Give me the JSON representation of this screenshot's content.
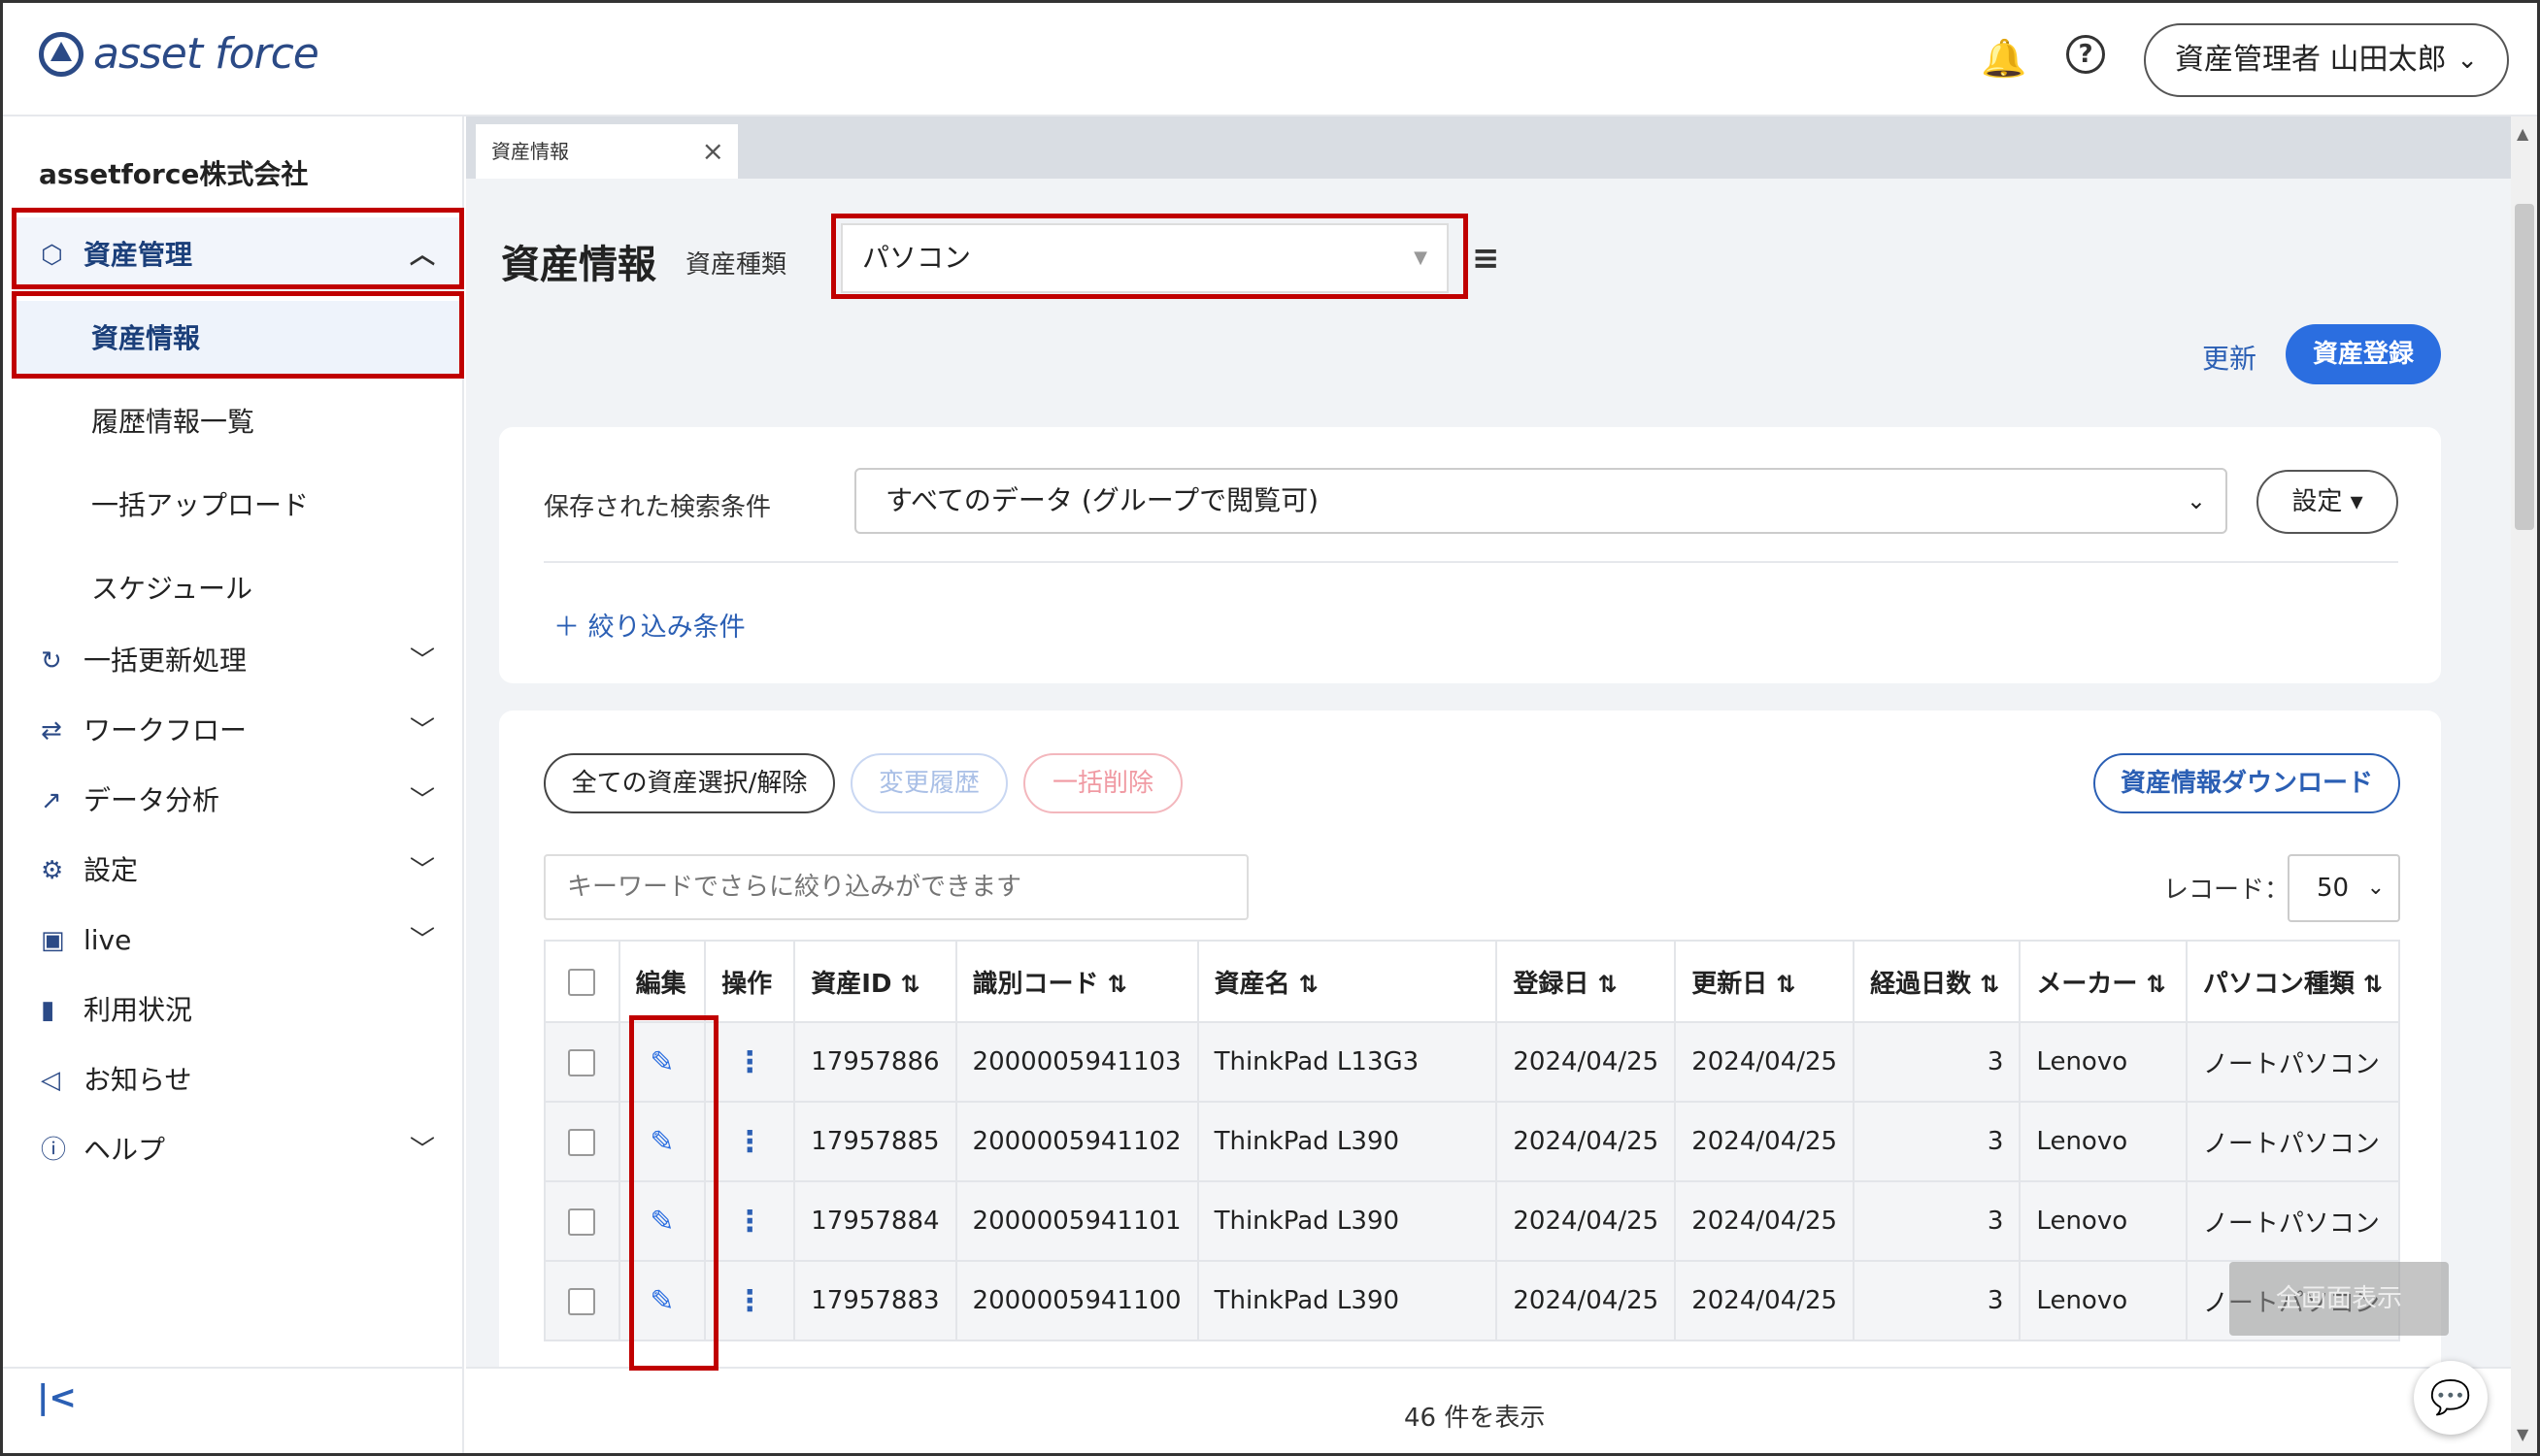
{
  "header": {
    "logo_text": "asset force",
    "user_label": "資産管理者 山田太郎"
  },
  "sidebar": {
    "company": "assetforce株式会社",
    "sections": [
      {
        "label": "資産管理",
        "icon": "box-icon"
      },
      {
        "label": "一括更新処理",
        "icon": "refresh-icon"
      },
      {
        "label": "ワークフロー",
        "icon": "workflow-icon"
      },
      {
        "label": "データ分析",
        "icon": "chart-icon"
      },
      {
        "label": "設定",
        "icon": "gear-icon"
      },
      {
        "label": "live",
        "icon": "live-icon"
      },
      {
        "label": "利用状況",
        "icon": "bar-chart-icon"
      },
      {
        "label": "お知らせ",
        "icon": "megaphone-icon"
      },
      {
        "label": "ヘルプ",
        "icon": "help-circle-icon"
      }
    ],
    "sub_items": [
      "資産情報",
      "履歴情報一覧",
      "一括アップロード",
      "スケジュール"
    ]
  },
  "tab": {
    "label": "資産情報"
  },
  "page": {
    "title": "資産情報",
    "type_label": "資産種類",
    "type_value": "パソコン",
    "refresh": "更新",
    "register": "資産登録"
  },
  "search": {
    "saved_label": "保存された検索条件",
    "saved_value": "すべてのデータ (グループで閲覧可)",
    "settings": "設定",
    "add_filter": "＋ 絞り込み条件"
  },
  "toolbar": {
    "select_all": "全ての資産選択/解除",
    "history": "変更履歴",
    "bulk_delete": "一括削除",
    "download": "資産情報ダウンロード",
    "keyword_placeholder": "キーワードでさらに絞り込みができます",
    "record_label": "レコード：",
    "record_value": "50"
  },
  "table": {
    "headers": [
      "編集",
      "操作",
      "資産ID",
      "識別コード",
      "資産名",
      "登録日",
      "更新日",
      "経過日数",
      "メーカー",
      "パソコン種類"
    ],
    "rows": [
      {
        "id": "17957886",
        "code": "2000005941103",
        "name": "ThinkPad L13G3",
        "reg": "2024/04/25",
        "upd": "2024/04/25",
        "days": "3",
        "maker": "Lenovo",
        "kind": "ノートパソコン"
      },
      {
        "id": "17957885",
        "code": "2000005941102",
        "name": "ThinkPad L390",
        "reg": "2024/04/25",
        "upd": "2024/04/25",
        "days": "3",
        "maker": "Lenovo",
        "kind": "ノートパソコン"
      },
      {
        "id": "17957884",
        "code": "2000005941101",
        "name": "ThinkPad L390",
        "reg": "2024/04/25",
        "upd": "2024/04/25",
        "days": "3",
        "maker": "Lenovo",
        "kind": "ノートパソコン"
      },
      {
        "id": "17957883",
        "code": "2000005941100",
        "name": "ThinkPad L390",
        "reg": "2024/04/25",
        "upd": "2024/04/25",
        "days": "3",
        "maker": "Lenovo",
        "kind": "ノートパソコン"
      }
    ]
  },
  "footer": {
    "count": "46 件を表示",
    "fullscreen": "全画面表示"
  },
  "colors": {
    "accent": "#2b6ee0",
    "brand": "#2b4a86",
    "highlight": "#c00000"
  }
}
